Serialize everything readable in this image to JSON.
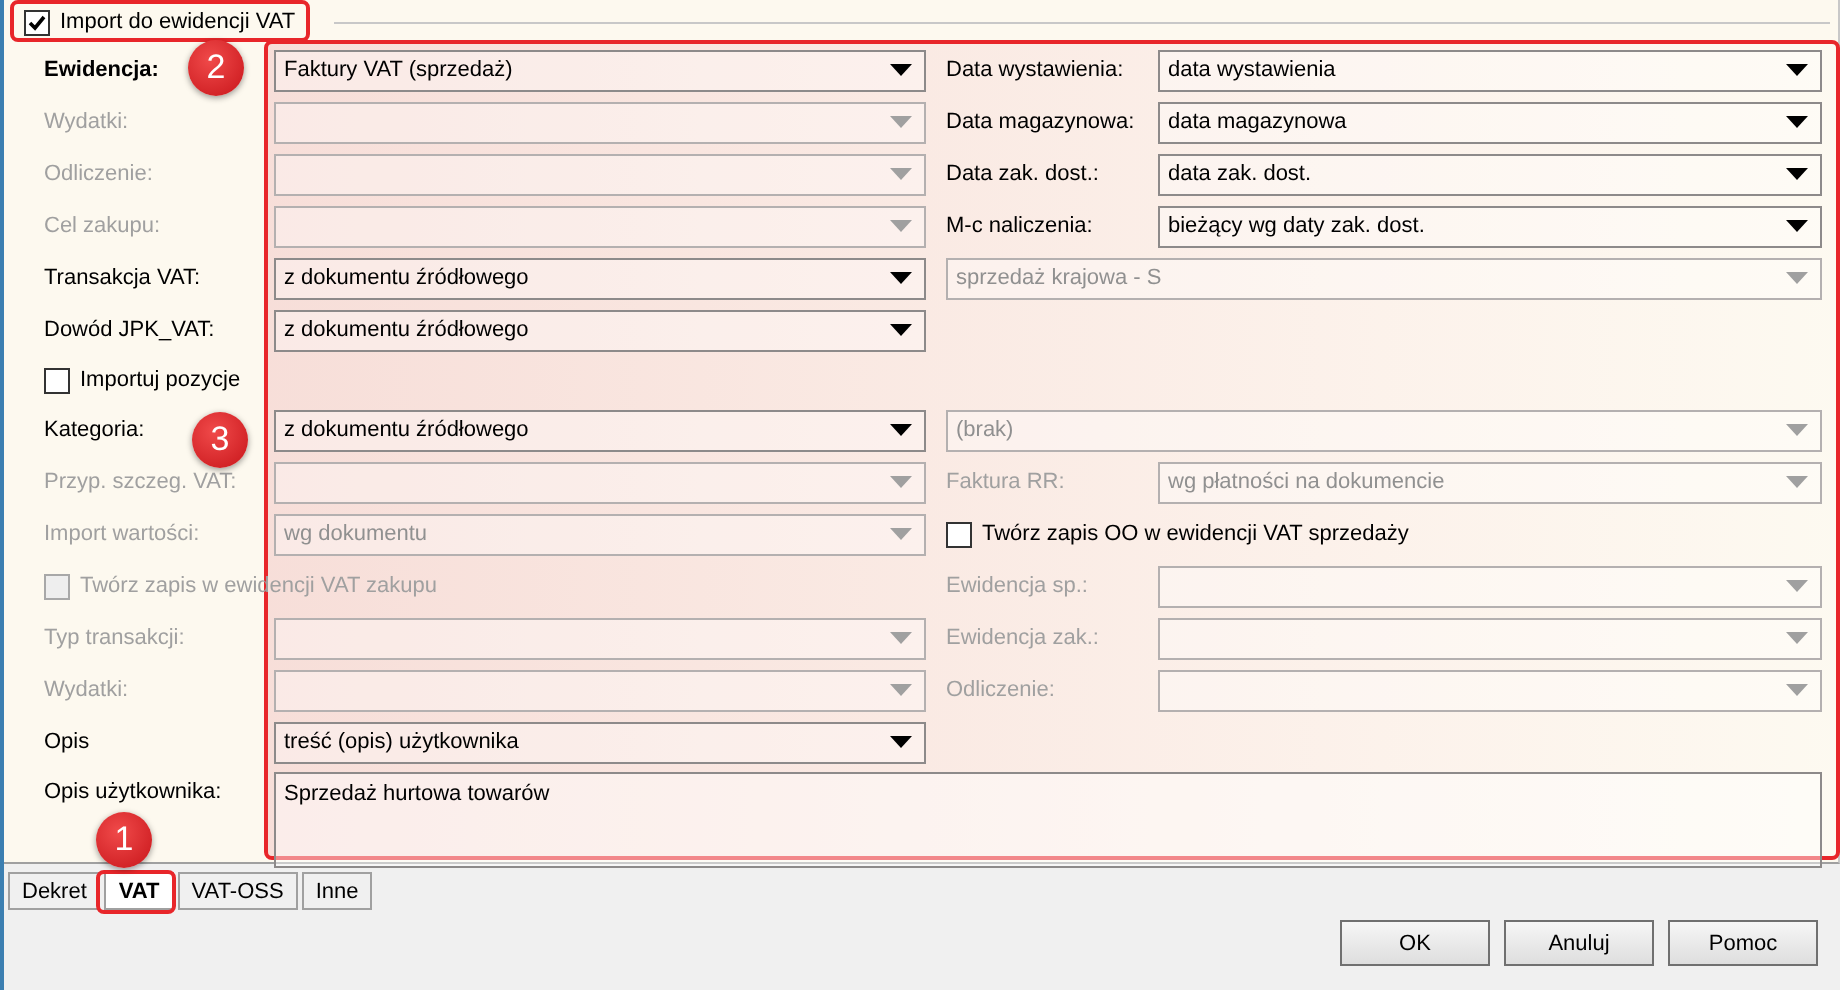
{
  "header": {
    "label": "Import do ewidencji VAT",
    "checked": true
  },
  "rows": [
    {
      "left": {
        "kind": "combo",
        "label": "Ewidencja:",
        "bold": true,
        "value": "Faktury VAT (sprzedaż)",
        "disabled": false
      },
      "right": {
        "kind": "combo",
        "label": "Data wystawienia:",
        "value": "data wystawienia",
        "disabled": false
      }
    },
    {
      "left": {
        "kind": "combo",
        "label": "Wydatki:",
        "disabled": true
      },
      "right": {
        "kind": "combo",
        "label": "Data magazynowa:",
        "value": "data magazynowa",
        "disabled": false
      }
    },
    {
      "left": {
        "kind": "combo",
        "label": "Odliczenie:",
        "disabled": true
      },
      "right": {
        "kind": "combo",
        "label": "Data zak. dost.:",
        "value": "data zak. dost.",
        "disabled": false
      }
    },
    {
      "left": {
        "kind": "combo",
        "label": "Cel zakupu:",
        "disabled": true
      },
      "right": {
        "kind": "combo",
        "label": "M-c naliczenia:",
        "value": "bieżący wg daty zak. dost.",
        "disabled": false
      }
    },
    {
      "left": {
        "kind": "combo",
        "label": "Transakcja VAT:",
        "value": "z dokumentu źródłowego",
        "disabled": false
      },
      "right": {
        "kind": "wide",
        "value": "sprzedaż krajowa - S",
        "disabled": true
      }
    },
    {
      "left": {
        "kind": "combo",
        "label": "Dowód JPK_VAT:",
        "value": "z dokumentu źródłowego",
        "disabled": false
      }
    },
    {
      "left": {
        "kind": "checkbox",
        "label": "Importuj pozycje",
        "checked": false,
        "disabled": false
      }
    },
    {
      "left": {
        "kind": "combo",
        "label": "Kategoria:",
        "value": "z dokumentu źródłowego",
        "disabled": false
      },
      "right": {
        "kind": "wide",
        "value": "(brak)",
        "disabled": true
      }
    },
    {
      "left": {
        "kind": "combo",
        "label": "Przyp. szczeg. VAT:",
        "disabled": true
      },
      "right": {
        "kind": "combo",
        "label": "Faktura RR:",
        "value": "wg płatności na dokumencie",
        "disabled": true
      }
    },
    {
      "left": {
        "kind": "combo",
        "label": "Import wartości:",
        "value": "wg dokumentu",
        "disabled": true
      },
      "right": {
        "kind": "checkbox",
        "label": "Twórz zapis OO w ewidencji VAT sprzedaży",
        "checked": false,
        "disabled": false
      }
    },
    {
      "left": {
        "kind": "checkbox",
        "label": "Twórz zapis w ewidencji VAT zakupu",
        "checked": false,
        "disabled": true
      },
      "right": {
        "kind": "combo",
        "label": "Ewidencja sp.:",
        "disabled": true
      }
    },
    {
      "left": {
        "kind": "combo",
        "label": "Typ transakcji:",
        "disabled": true
      },
      "right": {
        "kind": "combo",
        "label": "Ewidencja zak.:",
        "disabled": true
      }
    },
    {
      "left": {
        "kind": "combo",
        "label": "Wydatki:",
        "disabled": true
      },
      "right": {
        "kind": "combo",
        "label": "Odliczenie:",
        "disabled": true
      }
    },
    {
      "left": {
        "kind": "combo",
        "label": "Opis",
        "value": "treść (opis) użytkownika",
        "disabled": false
      }
    },
    {
      "left": {
        "kind": "textarea",
        "label": "Opis użytkownika:",
        "value": "Sprzedaż hurtowa towarów"
      }
    }
  ],
  "tabs": [
    {
      "label": "Dekret",
      "selected": false
    },
    {
      "label": "VAT",
      "selected": true
    },
    {
      "label": "VAT-OSS",
      "selected": false
    },
    {
      "label": "Inne",
      "selected": false
    }
  ],
  "buttons": [
    "OK",
    "Anuluj",
    "Pomoc"
  ],
  "markers": [
    "1",
    "2",
    "3"
  ]
}
